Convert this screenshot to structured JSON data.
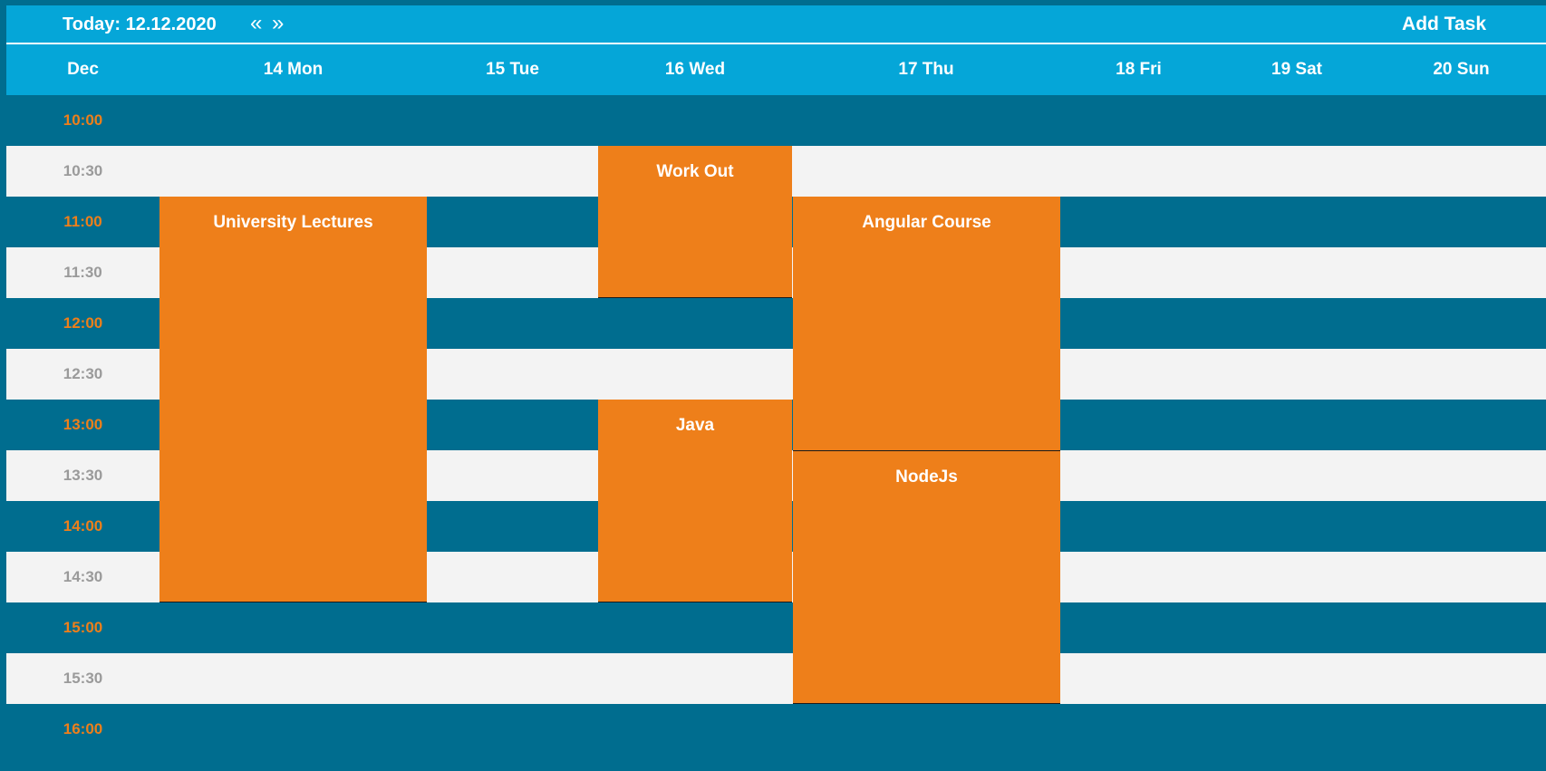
{
  "header": {
    "today_label": "Today: 12.12.2020",
    "prev_icon": "«",
    "next_icon": "»",
    "add_task_label": "Add Task"
  },
  "columns": {
    "month": "Dec",
    "days": [
      "14 Mon",
      "15 Tue",
      "16 Wed",
      "17 Thu",
      "18 Fri",
      "19 Sat",
      "20 Sun"
    ]
  },
  "times": [
    "10:00",
    "10:30",
    "11:00",
    "11:30",
    "12:00",
    "12:30",
    "13:00",
    "13:30",
    "14:00",
    "14:30",
    "15:00",
    "15:30",
    "16:00"
  ],
  "events": [
    {
      "title": "University Lectures",
      "day": "14 Mon",
      "start": "11:00",
      "end": "15:00"
    },
    {
      "title": "Work Out",
      "day": "16 Wed",
      "start": "10:30",
      "end": "12:00"
    },
    {
      "title": "Java",
      "day": "16 Wed",
      "start": "13:00",
      "end": "15:00"
    },
    {
      "title": "Angular Course",
      "day": "17 Thu",
      "start": "11:00",
      "end": "13:30"
    },
    {
      "title": "NodeJs",
      "day": "17 Thu",
      "start": "13:30",
      "end": "16:00"
    }
  ],
  "colors": {
    "header_bg": "#05a6d8",
    "row_dark": "#006d8f",
    "row_light": "#f3f3f3",
    "event": "#ee7f1a",
    "time_dark_text": "#ee7f1a",
    "time_light_text": "#9a9a9a"
  }
}
